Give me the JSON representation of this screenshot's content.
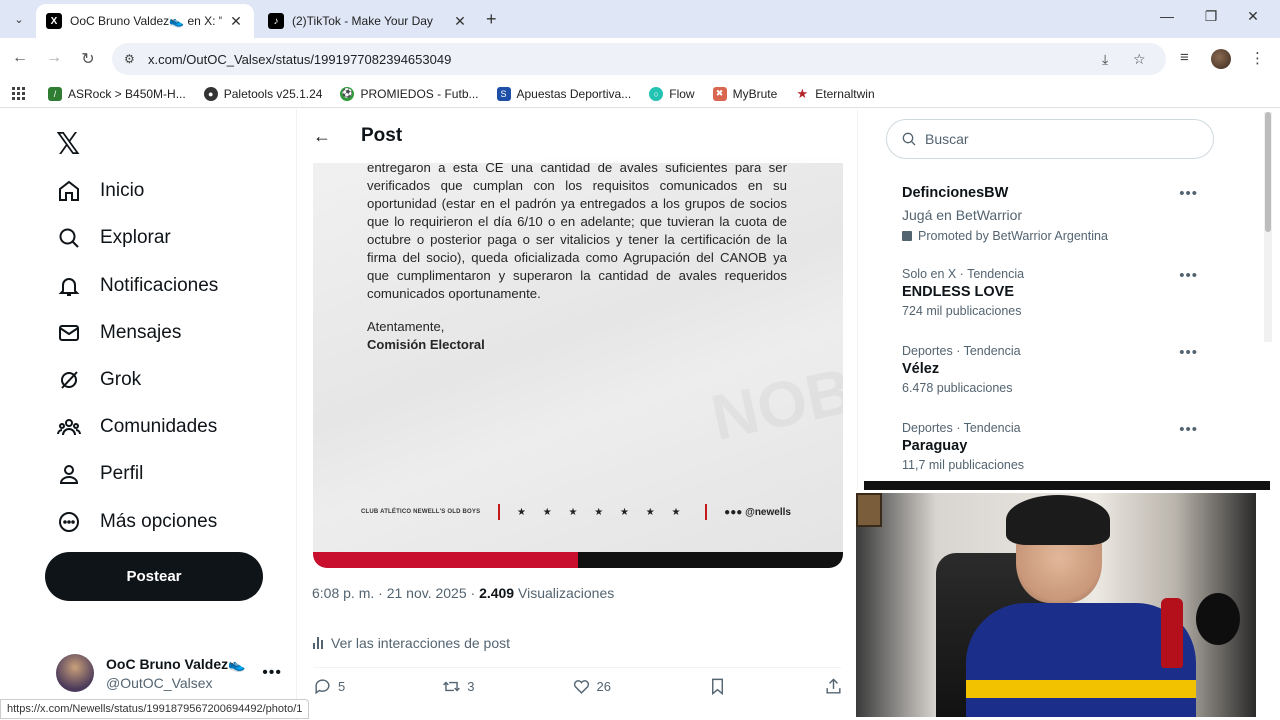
{
  "browser": {
    "tabs": [
      {
        "title": "OoC Bruno Valdez👟 en X: \"El C",
        "favicon": "x-logo",
        "active": true
      },
      {
        "title": "(2)TikTok - Make Your Day",
        "favicon": "tiktok-logo",
        "active": false
      }
    ],
    "url": "x.com/OutOC_Valsex/status/1991977082394653049",
    "bookmarks": [
      {
        "label": "ASRock > B450M-H...",
        "color": "#2e7d32"
      },
      {
        "label": "Paletools v25.1.24",
        "color": "#333333"
      },
      {
        "label": "PROMIEDOS - Futb...",
        "color": "#2e9d3a"
      },
      {
        "label": "Apuestas Deportiva...",
        "color": "#1e4fa8"
      },
      {
        "label": "Flow",
        "color": "#22c3b3"
      },
      {
        "label": "MyBrute",
        "color": "#d9664f"
      },
      {
        "label": "Eternaltwin",
        "color": "#b3262a"
      }
    ],
    "status_url": "https://x.com/Newells/status/1991879567200694492/photo/1"
  },
  "nav": {
    "items": [
      {
        "label": "Inicio",
        "icon": "home-icon"
      },
      {
        "label": "Explorar",
        "icon": "search-icon"
      },
      {
        "label": "Notificaciones",
        "icon": "bell-icon"
      },
      {
        "label": "Mensajes",
        "icon": "mail-icon"
      },
      {
        "label": "Grok",
        "icon": "grok-icon"
      },
      {
        "label": "Comunidades",
        "icon": "communities-icon"
      },
      {
        "label": "Perfil",
        "icon": "person-icon"
      },
      {
        "label": "Más opciones",
        "icon": "more-circle-icon"
      }
    ],
    "post_button": "Postear",
    "profile": {
      "name": "OoC Bruno Valdez👟",
      "handle": "@OutOC_Valsex"
    }
  },
  "post": {
    "header": "Post",
    "document": {
      "body": "entregaron a esta CE una cantidad de avales suficientes para ser verificados que cumplan con los requisitos comunicados en su oportunidad (estar en el padrón ya entregados a los grupos de socios que lo requirieron el día 6/10 o en adelante; que tuvieran la cuota de octubre o posterior paga o ser vitalicios y tener la certificación de la firma del socio), queda oficializada como Agrupación del CANOB ya que cumplimentaron y superaron la cantidad de avales requeridos comunicados oportunamente.",
      "closing": "Atentamente,",
      "signature": "Comisión Electoral",
      "footer_club": "CLUB ATLÉTICO NEWELL'S OLD BOYS",
      "footer_stars": "★ ★ ★ ★ ★ ★ ★",
      "footer_social": "●●● @newells"
    },
    "time": "6:08 p. m. · 21 nov. 2025 · ",
    "views_count": "2.409",
    "views_label": " Visualizaciones",
    "interactions_link": "Ver las interacciones de post",
    "replies": "5",
    "reposts": "3",
    "likes": "26"
  },
  "sidebar": {
    "search_placeholder": "Buscar",
    "ad": {
      "title": "DefincionesBW",
      "subtitle": "Jugá en BetWarrior",
      "promoted": "Promoted by BetWarrior Argentina"
    },
    "trends": [
      {
        "category": "Solo en X · Tendencia",
        "topic": "ENDLESS LOVE",
        "count": "724 mil publicaciones"
      },
      {
        "category": "Deportes · Tendencia",
        "topic": "Vélez",
        "count": "6.478 publicaciones"
      },
      {
        "category": "Deportes · Tendencia",
        "topic": "Paraguay",
        "count": "11,7 mil publicaciones"
      }
    ]
  }
}
